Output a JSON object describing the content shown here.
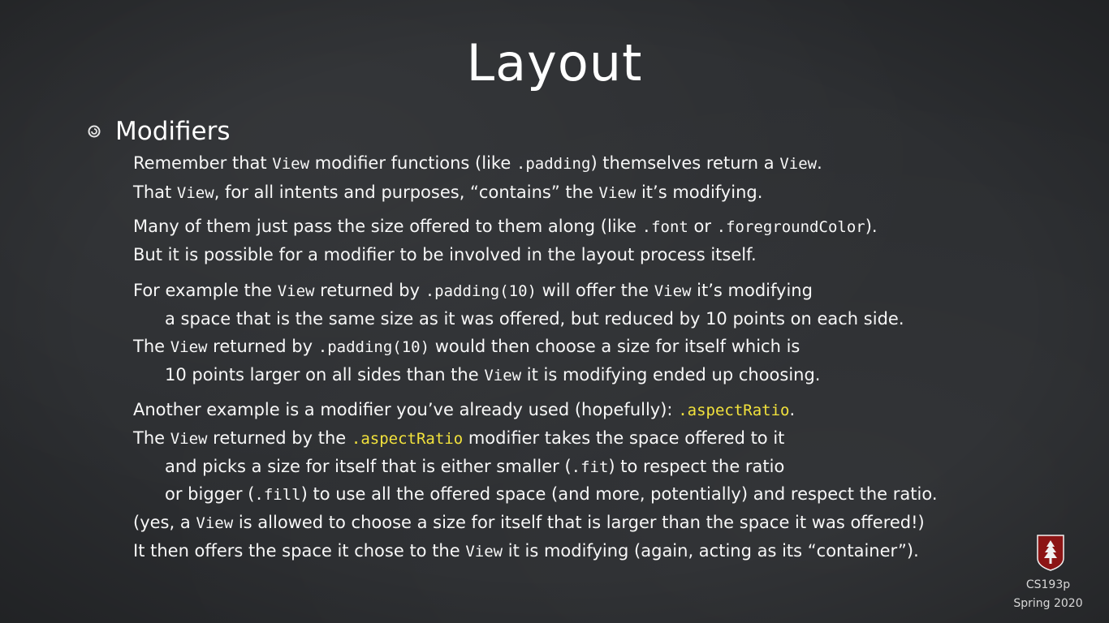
{
  "title": "Layout",
  "bullet": {
    "heading": "Modifiers"
  },
  "lines": [
    {
      "indent": 0,
      "segments": [
        {
          "t": "Remember that "
        },
        {
          "t": "View",
          "c": true
        },
        {
          "t": " modifier functions (like "
        },
        {
          "t": ".padding",
          "c": true
        },
        {
          "t": ") themselves return a "
        },
        {
          "t": "View",
          "c": true
        },
        {
          "t": "."
        }
      ]
    },
    {
      "indent": 0,
      "segments": [
        {
          "t": "That "
        },
        {
          "t": "View",
          "c": true
        },
        {
          "t": ", for all intents and purposes, “contains” the "
        },
        {
          "t": "View",
          "c": true
        },
        {
          "t": " it’s modifying."
        }
      ]
    },
    {
      "indent": 0,
      "segments": [
        {
          "t": "Many of them just pass the size offered to them along (like "
        },
        {
          "t": ".font",
          "c": true
        },
        {
          "t": " or "
        },
        {
          "t": ".foregroundColor",
          "c": true
        },
        {
          "t": ")."
        }
      ]
    },
    {
      "indent": 0,
      "segments": [
        {
          "t": "But it is possible for a modifier to be involved in the layout process itself."
        }
      ]
    },
    {
      "indent": 0,
      "segments": [
        {
          "t": "For example the "
        },
        {
          "t": "View",
          "c": true
        },
        {
          "t": " returned by "
        },
        {
          "t": ".padding(10)",
          "c": true
        },
        {
          "t": " will offer the "
        },
        {
          "t": "View",
          "c": true
        },
        {
          "t": " it’s modifying"
        }
      ]
    },
    {
      "indent": 1,
      "segments": [
        {
          "t": "a space that is the same size as it was offered, but reduced by 10 points on each side."
        }
      ]
    },
    {
      "indent": 0,
      "segments": [
        {
          "t": "The "
        },
        {
          "t": "View",
          "c": true
        },
        {
          "t": " returned by "
        },
        {
          "t": ".padding(10)",
          "c": true
        },
        {
          "t": " would then choose a size for itself which is"
        }
      ]
    },
    {
      "indent": 1,
      "segments": [
        {
          "t": "10 points larger on all sides than the "
        },
        {
          "t": "View",
          "c": true
        },
        {
          "t": " it is modifying ended up choosing."
        }
      ]
    },
    {
      "indent": 0,
      "segments": [
        {
          "t": "Another example is a modifier you’ve already used (hopefully): "
        },
        {
          "t": ".aspectRatio",
          "c": true,
          "hl": true
        },
        {
          "t": "."
        }
      ]
    },
    {
      "indent": 0,
      "segments": [
        {
          "t": "The "
        },
        {
          "t": "View",
          "c": true
        },
        {
          "t": " returned by the "
        },
        {
          "t": ".aspectRatio",
          "c": true,
          "hl": true
        },
        {
          "t": " modifier takes the space offered to it"
        }
      ]
    },
    {
      "indent": 1,
      "segments": [
        {
          "t": "and picks a size for itself that is either smaller ("
        },
        {
          "t": ".fit",
          "c": true
        },
        {
          "t": ") to respect the ratio"
        }
      ]
    },
    {
      "indent": 1,
      "segments": [
        {
          "t": "or bigger ("
        },
        {
          "t": ".fill",
          "c": true
        },
        {
          "t": ") to use all the offered space (and more, potentially) and respect the ratio."
        }
      ]
    },
    {
      "indent": 0,
      "segments": [
        {
          "t": "(yes, a "
        },
        {
          "t": "View",
          "c": true
        },
        {
          "t": " is allowed to choose a size for itself that is larger than the space it was offered!)"
        }
      ]
    },
    {
      "indent": 0,
      "segments": [
        {
          "t": "It then offers the space it chose to the "
        },
        {
          "t": "View",
          "c": true
        },
        {
          "t": " it is modifying (again, acting as its “container”)."
        }
      ]
    }
  ],
  "footer": {
    "course": "CS193p",
    "term": "Spring 2020"
  },
  "colors": {
    "background": "#2c2e31",
    "text": "#ffffff",
    "highlight": "#f2e23c",
    "badge": "#8c1515"
  }
}
